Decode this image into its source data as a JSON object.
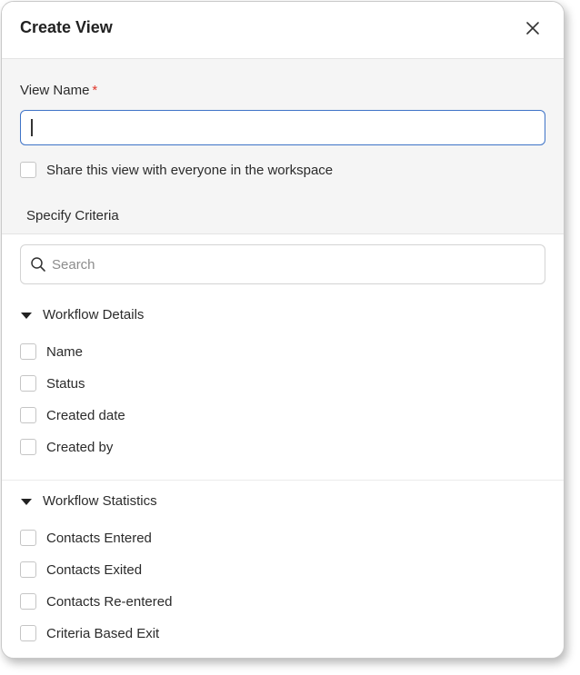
{
  "dialog": {
    "title": "Create View",
    "close_icon": "close-icon"
  },
  "view_name": {
    "label": "View Name",
    "required_marker": "*",
    "value": "",
    "placeholder": ""
  },
  "share": {
    "label": "Share this view with everyone in the workspace",
    "checked": false
  },
  "criteria": {
    "label": "Specify Criteria",
    "search_placeholder": "Search"
  },
  "groups": [
    {
      "title": "Workflow Details",
      "expanded": true,
      "items": [
        {
          "label": "Name",
          "checked": false
        },
        {
          "label": "Status",
          "checked": false
        },
        {
          "label": "Created date",
          "checked": false
        },
        {
          "label": "Created by",
          "checked": false
        }
      ]
    },
    {
      "title": "Workflow Statistics",
      "expanded": true,
      "items": [
        {
          "label": "Contacts Entered",
          "checked": false
        },
        {
          "label": "Contacts Exited",
          "checked": false
        },
        {
          "label": "Contacts Re-entered",
          "checked": false
        },
        {
          "label": "Criteria Based Exit",
          "checked": false
        }
      ]
    }
  ],
  "colors": {
    "accent": "#3e73c7",
    "required": "#e0372b",
    "panel_bg": "#f5f5f5"
  }
}
